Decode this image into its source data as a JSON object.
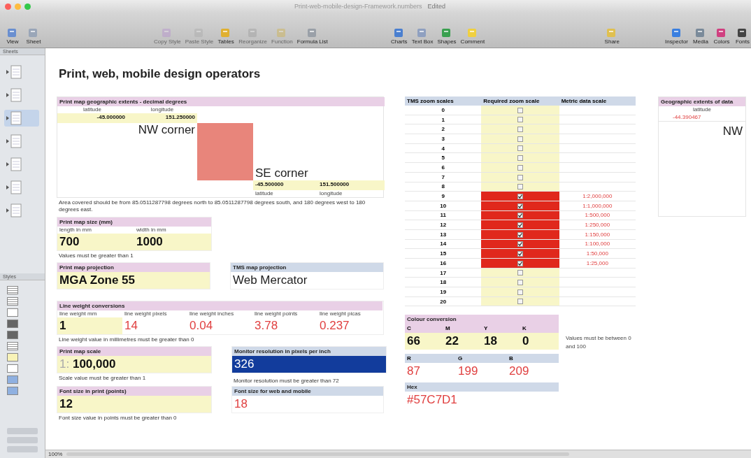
{
  "window": {
    "title": "Print-web-mobile-design-Framework.numbers",
    "status": "Edited"
  },
  "toolbar": {
    "left": [
      {
        "label": "View",
        "disabled": false
      },
      {
        "label": "Sheet",
        "disabled": false
      }
    ],
    "middle": [
      {
        "label": "Copy Style",
        "disabled": true
      },
      {
        "label": "Paste Style",
        "disabled": true
      },
      {
        "label": "Tables",
        "disabled": false
      },
      {
        "label": "Reorganize",
        "disabled": true
      },
      {
        "label": "Function",
        "disabled": true
      },
      {
        "label": "Formula List",
        "disabled": false
      }
    ],
    "insert": [
      {
        "label": "Charts",
        "disabled": false
      },
      {
        "label": "Text Box",
        "disabled": false
      },
      {
        "label": "Shapes",
        "disabled": false
      },
      {
        "label": "Comment",
        "disabled": false
      }
    ],
    "share": [
      {
        "label": "Share",
        "disabled": false
      }
    ],
    "right": [
      {
        "label": "Inspector",
        "disabled": false
      },
      {
        "label": "Media",
        "disabled": false
      },
      {
        "label": "Colors",
        "disabled": false
      },
      {
        "label": "Fonts",
        "disabled": false
      }
    ]
  },
  "sidebar": {
    "sheets_label": "Sheets",
    "sheets": [
      {
        "selected": false
      },
      {
        "selected": false
      },
      {
        "selected": true
      },
      {
        "selected": false
      },
      {
        "selected": false
      },
      {
        "selected": false
      },
      {
        "selected": false
      }
    ],
    "styles_label": "Styles",
    "styles": [
      {
        "kind": "lined"
      },
      {
        "kind": "lined"
      },
      {
        "kind": "plain"
      },
      {
        "kind": "dark"
      },
      {
        "kind": "dark"
      },
      {
        "kind": "lined"
      },
      {
        "kind": "yellow"
      },
      {
        "kind": "plain"
      },
      {
        "kind": "blue"
      },
      {
        "kind": "blue"
      }
    ]
  },
  "sheet": {
    "title": "Print, web, mobile design operators",
    "extents": {
      "header": "Print map geographic extents - decimal degrees",
      "kind": "input",
      "nw": {
        "labels": [
          "latitude",
          "longitude"
        ],
        "values": [
          "-45.000000",
          "151.250000"
        ],
        "caption": "NW corner"
      },
      "se": {
        "labels": [
          "latitude",
          "longitude"
        ],
        "values": [
          "-45.500000",
          "151.500000"
        ],
        "caption": "SE corner"
      },
      "note": "Area covered should be from 85.0511287798 degrees north to 85.0511287798 degrees south, and 180 degrees west to 180 degrees east."
    },
    "map_size": {
      "header": "Print map size (mm)",
      "kind": "input",
      "fields": [
        {
          "label": "length in mm",
          "value": "700"
        },
        {
          "label": "width in mm",
          "value": "1000"
        }
      ],
      "note": "Values must be greater than 1"
    },
    "print_projection": {
      "header": "Print map projection",
      "kind": "input",
      "value": "MGA Zone 55"
    },
    "tms_projection": {
      "header": "TMS map projection",
      "kind": "output",
      "value": "Web Mercator"
    },
    "line_weight": {
      "header": "Line weight conversions",
      "fields": [
        {
          "label": "line weight mm",
          "value": "1",
          "kind": "input"
        },
        {
          "label": "line weight pixels",
          "value": "14",
          "kind": "output"
        },
        {
          "label": "line weight inches",
          "value": "0.04",
          "kind": "output"
        },
        {
          "label": "line weight points",
          "value": "3.78",
          "kind": "output"
        },
        {
          "label": "line weight picas",
          "value": "0.237",
          "kind": "output"
        }
      ],
      "note": "Line weight value in millimetres must be greater than 0"
    },
    "print_scale": {
      "header": "Print map scale",
      "kind": "input",
      "prefix": "1:",
      "value": "100,000",
      "note": "Scale value must be greater than 1"
    },
    "monitor": {
      "header": "Monitor resolution in pixels per inch",
      "kind": "output",
      "value": "326",
      "selected": true,
      "note": "Monitor resolution must be greater than 72"
    },
    "font_print": {
      "header": "Font size in print (points)",
      "kind": "input",
      "value": "12",
      "note": "Font size value in points must be greater than 0"
    },
    "font_web": {
      "header": "Font size for web and mobile",
      "kind": "output",
      "value": "18"
    },
    "zoom_table": {
      "columns": [
        "TMS zoom scales",
        "Required zoom scale",
        "Metric data scale"
      ],
      "rows": [
        {
          "zoom": "0",
          "checked": false
        },
        {
          "zoom": "1",
          "checked": false
        },
        {
          "zoom": "2",
          "checked": false
        },
        {
          "zoom": "3",
          "checked": false
        },
        {
          "zoom": "4",
          "checked": false
        },
        {
          "zoom": "5",
          "checked": false
        },
        {
          "zoom": "6",
          "checked": false
        },
        {
          "zoom": "7",
          "checked": false
        },
        {
          "zoom": "8",
          "checked": false
        },
        {
          "zoom": "9",
          "checked": true,
          "scale": "1:2,000,000"
        },
        {
          "zoom": "10",
          "checked": true,
          "scale": "1:1,000,000"
        },
        {
          "zoom": "11",
          "checked": true,
          "scale": "1:500,000"
        },
        {
          "zoom": "12",
          "checked": true,
          "scale": "1:250,000"
        },
        {
          "zoom": "13",
          "checked": true,
          "scale": "1:150,000"
        },
        {
          "zoom": "14",
          "checked": true,
          "scale": "1:100,000"
        },
        {
          "zoom": "15",
          "checked": true,
          "scale": "1:50,000"
        },
        {
          "zoom": "16",
          "checked": true,
          "scale": "1:25,000"
        },
        {
          "zoom": "17",
          "checked": false
        },
        {
          "zoom": "18",
          "checked": false
        },
        {
          "zoom": "19",
          "checked": false
        },
        {
          "zoom": "20",
          "checked": false
        }
      ]
    },
    "colour": {
      "header": "Colour conversion",
      "cmyk": [
        {
          "label": "C",
          "value": "66"
        },
        {
          "label": "M",
          "value": "22"
        },
        {
          "label": "Y",
          "value": "18"
        },
        {
          "label": "K",
          "value": "0"
        }
      ],
      "note": "Values must be between 0 and 100",
      "rgb": [
        {
          "label": "R",
          "value": "87"
        },
        {
          "label": "G",
          "value": "199"
        },
        {
          "label": "B",
          "value": "209"
        }
      ],
      "hex_header": "Hex",
      "hex": "#57C7D1"
    },
    "data_extents": {
      "header": "Geographic extents of data",
      "label": "latitude",
      "value": "-44.390467",
      "caption": "NW"
    }
  },
  "statusbar": {
    "zoom": "100%"
  }
}
